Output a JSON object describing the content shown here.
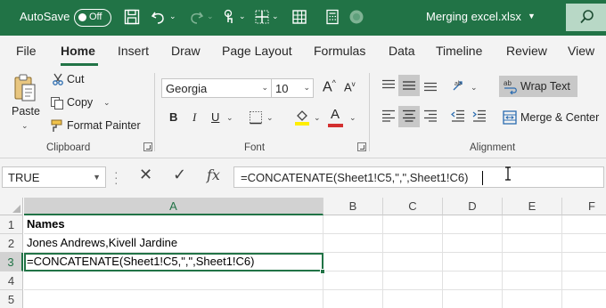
{
  "titlebar": {
    "autosave_label": "AutoSave",
    "autosave_state": "Off",
    "filename": "Merging excel.xlsx",
    "icons": [
      "save-icon",
      "undo-icon",
      "redo-icon",
      "touch-mode-icon",
      "borders-icon",
      "table-icon",
      "circle-icon",
      "search-icon"
    ]
  },
  "tabs": [
    "File",
    "Home",
    "Insert",
    "Draw",
    "Page Layout",
    "Formulas",
    "Data",
    "Timeline",
    "Review",
    "View"
  ],
  "ribbon": {
    "clipboard": {
      "paste": "Paste",
      "cut": "Cut",
      "copy": "Copy",
      "format_painter": "Format Painter",
      "label": "Clipboard"
    },
    "font": {
      "font_name": "Georgia",
      "font_size": "10",
      "bold": "B",
      "italic": "I",
      "underline": "U",
      "grow": "A",
      "shrink": "A",
      "font_color_letter": "A",
      "label": "Font",
      "font_color": "#d32f2f",
      "highlight_color": "#ffee00"
    },
    "alignment": {
      "wrap_text": "Wrap Text",
      "merge_center": "Merge & Center",
      "label": "Alignment"
    }
  },
  "formula_bar": {
    "name_box": "TRUE",
    "cancel": "✕",
    "enter": "✓",
    "fx": "fx",
    "formula": "=CONCATENATE(Sheet1!C5,\",\",Sheet1!C6)"
  },
  "sheet": {
    "columns": [
      "A",
      "B",
      "C",
      "D",
      "E",
      "F"
    ],
    "rows": [
      "1",
      "2",
      "3",
      "4",
      "5"
    ],
    "cells": {
      "A1": "Names",
      "A2": "Jones Andrews,Kivell Jardine",
      "A3": "=CONCATENATE(Sheet1!C5,\",\",Sheet1!C6)"
    },
    "active_cell": "A3",
    "accent": "#217346"
  }
}
